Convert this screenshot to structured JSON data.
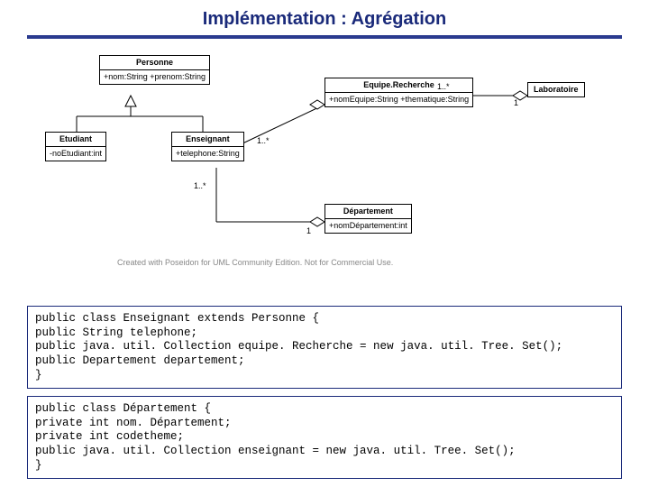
{
  "title": "Implémentation : Agrégation",
  "uml": {
    "personne": {
      "name": "Personne",
      "attrs": "+nom:String\n+prenom:String"
    },
    "etudiant": {
      "name": "Etudiant",
      "attrs": "-noEtudiant:int"
    },
    "enseignant": {
      "name": "Enseignant",
      "attrs": "+telephone:String"
    },
    "equipe": {
      "name": "Equipe.Recherche",
      "attrs": "+nomEquipe:String\n+thematique:String"
    },
    "laboratoire": {
      "name": "Laboratoire"
    },
    "departement": {
      "name": "Département",
      "attrs": "+nomDépartement:int"
    }
  },
  "mult": {
    "ens_eq": "1..*",
    "eq_lab_left": "1..*",
    "eq_lab_right": "1",
    "ens_dep_top": "1..*",
    "ens_dep_bottom": "1"
  },
  "watermark": "Created with Poseidon for UML Community Edition. Not for Commercial Use.",
  "code1": {
    "l1": "public class Enseignant extends Personne {",
    "l2": "  public String telephone;",
    "l3": "  public java. util. Collection equipe. Recherche = new java. util. Tree. Set();",
    "l4": "  public Departement departement;",
    "l5": "}"
  },
  "code2": {
    "l1": "public class Département {",
    "l2": "private int nom. Département;",
    "l3": "private int codetheme;",
    "l4": "public java. util. Collection enseignant = new java. util. Tree. Set();",
    "l5": "}"
  }
}
